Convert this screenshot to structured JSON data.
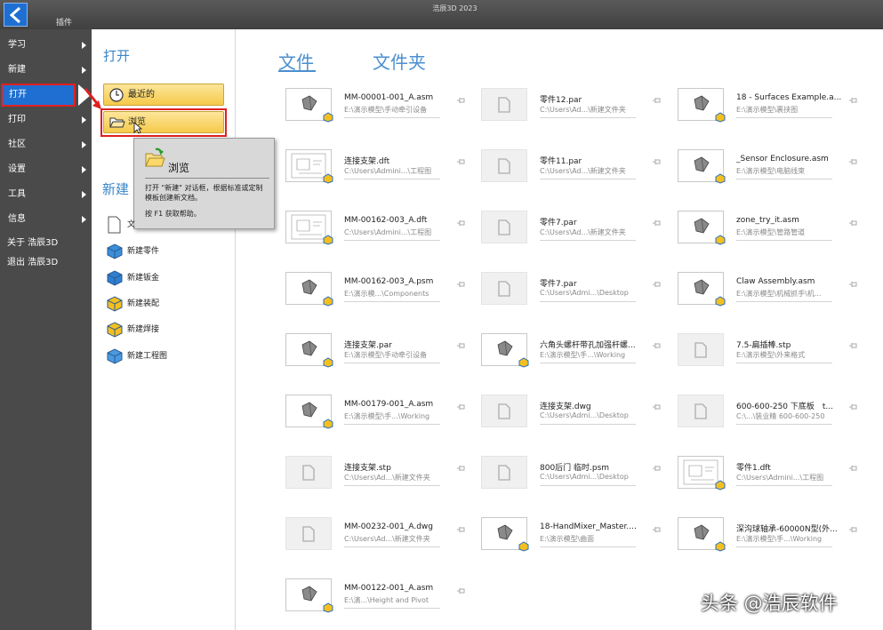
{
  "app": {
    "title": "浩辰3D 2023",
    "plugin_tab": "插件"
  },
  "nav": {
    "items": [
      "学习",
      "新建",
      "打开",
      "打印",
      "社区",
      "设置",
      "工具",
      "信息"
    ],
    "about": "关于 浩辰3D",
    "exit": "退出 浩辰3D",
    "active": "打开"
  },
  "open_panel": {
    "title": "打开",
    "recent": "最近的",
    "browse": "浏览"
  },
  "tooltip": {
    "title": "浏览",
    "body": "打开 \"新建\" 对话框，根据标准或定制模板创建新文档。",
    "help": "按 F1 获取帮助。"
  },
  "new_panel": {
    "title": "新建",
    "items": [
      "文",
      "新建零件",
      "新建钣金",
      "新建装配",
      "新建焊接",
      "新建工程图"
    ]
  },
  "tabs": {
    "files": "文件",
    "folders": "文件夹"
  },
  "files": [
    {
      "name": "MM-00001-001_A.asm",
      "path": "E:\\演示模型\\手动牵引设备",
      "icon": "asm"
    },
    {
      "name": "零件12.par",
      "path": "C:\\Users\\Ad...\\新建文件夹",
      "icon": "par"
    },
    {
      "name": "18 - Surfaces Example.a...",
      "path": "E:\\演示模型\\裹挟图",
      "icon": "asm"
    },
    {
      "name": "连接支架.dft",
      "path": "C:\\Users\\Admini...\\工程图",
      "icon": "dft"
    },
    {
      "name": "零件11.par",
      "path": "C:\\Users\\Ad...\\新建文件夹",
      "icon": "par"
    },
    {
      "name": "_Sensor Enclosure.asm",
      "path": "E:\\演示模型\\电脑线束",
      "icon": "asm"
    },
    {
      "name": "MM-00162-003_A.dft",
      "path": "C:\\Users\\Admini...\\工程图",
      "icon": "dft"
    },
    {
      "name": "零件7.par",
      "path": "C:\\Users\\Ad...\\新建文件夹",
      "icon": "par"
    },
    {
      "name": "zone_try_it.asm",
      "path": "E:\\演示模型\\管路管道",
      "icon": "asm"
    },
    {
      "name": "MM-00162-003_A.psm",
      "path": "E:\\演示模...\\Components",
      "icon": "psm"
    },
    {
      "name": "零件7.par",
      "path": "C:\\Users\\Admi...\\Desktop",
      "icon": "par"
    },
    {
      "name": "Claw Assembly.asm",
      "path": "E:\\演示模型\\机械抓手\\机...",
      "icon": "asm"
    },
    {
      "name": "连接支架.par",
      "path": "E:\\演示模型\\手动牵引设备",
      "icon": "par"
    },
    {
      "name": "六角头螺杆带孔加强杆螺...",
      "path": "E:\\演示模型\\手...\\Working",
      "icon": "par"
    },
    {
      "name": "7.5-扁插棒.stp",
      "path": "E:\\演示模型\\外来格式",
      "icon": "stp"
    },
    {
      "name": "MM-00179-001_A.asm",
      "path": "E:\\演示模型\\手...\\Working",
      "icon": "asm"
    },
    {
      "name": "连接支架.dwg",
      "path": "C:\\Users\\Admi...\\Desktop",
      "icon": "dwg"
    },
    {
      "name": "600-600-250 下底板　t...",
      "path": "C:\\...\\装业精 600-600-250",
      "icon": "dwg"
    },
    {
      "name": "连接支架.stp",
      "path": "C:\\Users\\Ad...\\新建文件夹",
      "icon": "stp"
    },
    {
      "name": "800后门 临时.psm",
      "path": "C:\\Users\\Admi...\\Desktop",
      "icon": "psm"
    },
    {
      "name": "零件1.dft",
      "path": "C:\\Users\\Admini...\\工程图",
      "icon": "dft"
    },
    {
      "name": "MM-00232-001_A.dwg",
      "path": "C:\\Users\\Ad...\\新建文件夹",
      "icon": "dwg"
    },
    {
      "name": "18-HandMixer_Master....",
      "path": "E:\\演示模型\\曲面",
      "icon": "par"
    },
    {
      "name": "深沟球轴承-60000N型(外...",
      "path": "E:\\演示模型\\手...\\Working",
      "icon": "par"
    },
    {
      "name": "MM-00122-001_A.asm",
      "path": "E:\\演...\\Height and Pivot",
      "icon": "asm"
    }
  ],
  "watermark": "头条 @浩辰软件",
  "colors": {
    "accent": "#1e6fd1",
    "highlight": "#e02020",
    "tab_blue": "#4a8fd0"
  }
}
